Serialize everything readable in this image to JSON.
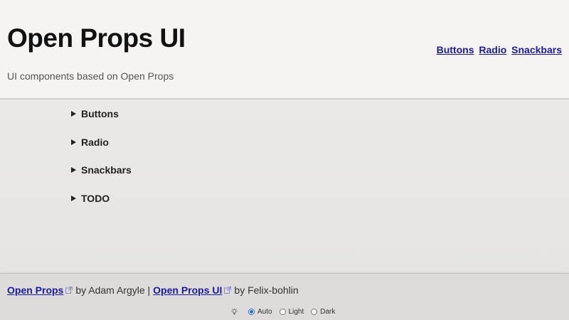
{
  "header": {
    "title": "Open Props UI",
    "subtitle": "UI components based on Open Props",
    "nav": [
      "Buttons",
      "Radio",
      "Snackbars"
    ]
  },
  "sections": [
    "Buttons",
    "Radio",
    "Snackbars",
    "TODO"
  ],
  "footer": {
    "credit1_link": "Open Props",
    "credit1_by": "by Adam Argyle |",
    "credit2_link": "Open Props UI",
    "credit2_by": "by Felix-bohlin",
    "theme": {
      "icon": "lightbulb-icon",
      "options": [
        "Auto",
        "Light",
        "Dark"
      ],
      "selected": "Auto"
    }
  },
  "colors": {
    "link": "#1a1aa6",
    "radio_accent": "#1f6fd1",
    "header_bg": "#f5f4f2",
    "main_bg": "#e6e5e3",
    "footer_bg": "#dddcdb"
  }
}
